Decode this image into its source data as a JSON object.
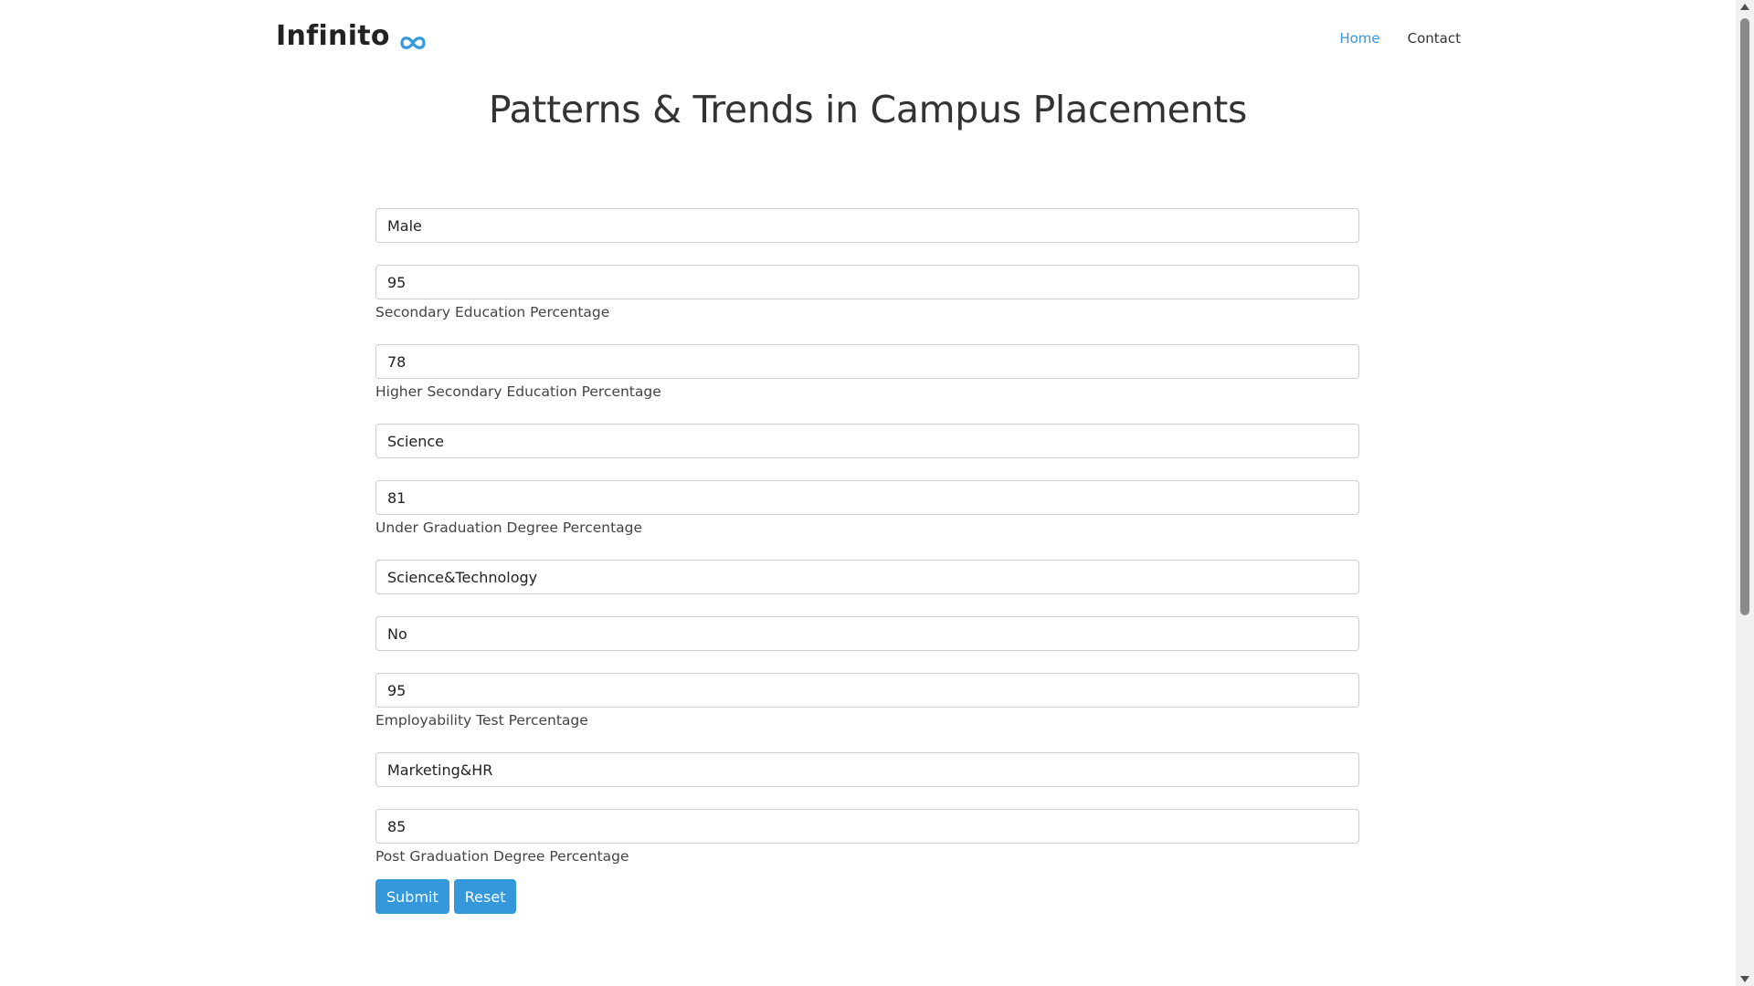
{
  "header": {
    "logo_text": "Infinito",
    "logo_icon": "infinity-icon",
    "accent_color": "#3498db",
    "nav": [
      {
        "label": "Home",
        "active": true
      },
      {
        "label": "Contact",
        "active": false
      }
    ]
  },
  "page": {
    "title": "Patterns & Trends in Campus Placements"
  },
  "form": {
    "fields": [
      {
        "value": "Male",
        "hint": ""
      },
      {
        "value": "95",
        "hint": "Secondary Education Percentage"
      },
      {
        "value": "78",
        "hint": "Higher Secondary Education Percentage"
      },
      {
        "value": "Science",
        "hint": ""
      },
      {
        "value": "81",
        "hint": "Under Graduation Degree Percentage"
      },
      {
        "value": "Science&Technology",
        "hint": ""
      },
      {
        "value": "No",
        "hint": ""
      },
      {
        "value": "95",
        "hint": "Employability Test Percentage"
      },
      {
        "value": "Marketing&HR",
        "hint": ""
      },
      {
        "value": "85",
        "hint": "Post Graduation Degree Percentage"
      }
    ],
    "submit_label": "Submit",
    "reset_label": "Reset"
  }
}
